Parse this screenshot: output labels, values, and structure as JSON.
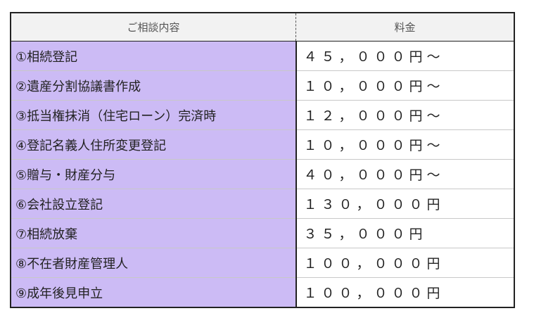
{
  "table": {
    "headers": {
      "service": "ご相談内容",
      "fee": "料金"
    },
    "rows": [
      {
        "service": "①相続登記",
        "fee": "４５，０００円～"
      },
      {
        "service": "②遺産分割協議書作成",
        "fee": "１０，０００円～"
      },
      {
        "service": "③抵当権抹消（住宅ローン）完済時",
        "fee": "１２，０００円～"
      },
      {
        "service": "④登記名義人住所変更登記",
        "fee": "１０，０００円～"
      },
      {
        "service": "⑤贈与・財産分与",
        "fee": "４０，０００円～"
      },
      {
        "service": "⑥会社設立登記",
        "fee": "１３０，０００円"
      },
      {
        "service": "⑦相続放棄",
        "fee": "３５，０００円"
      },
      {
        "service": "⑧不在者財産管理人",
        "fee": "１００，０００円"
      },
      {
        "service": "⑨成年後見申立",
        "fee": "１００，０００円"
      }
    ]
  },
  "colors": {
    "service_cell_bg": "#ccbbf5",
    "header_bg": "#f2f2f2",
    "border": "#222222"
  }
}
